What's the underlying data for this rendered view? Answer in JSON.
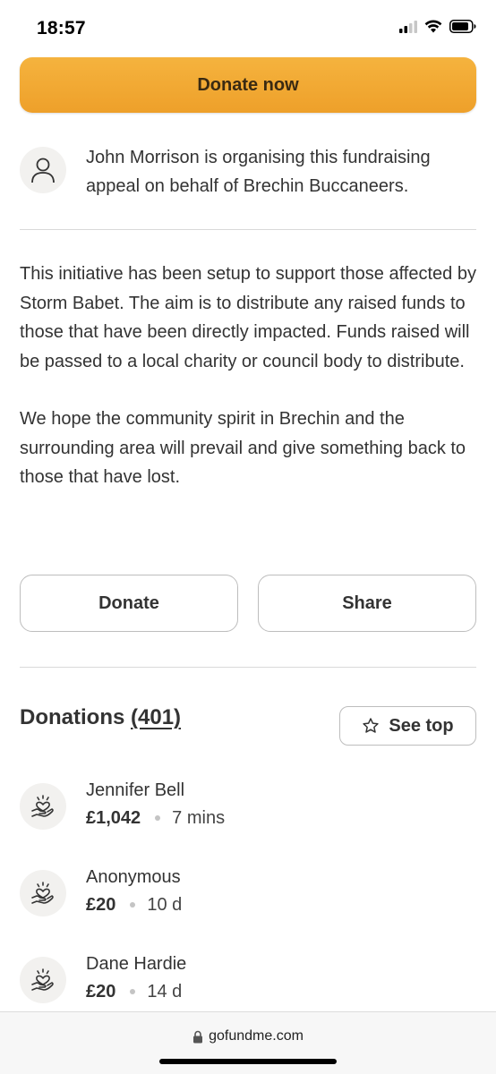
{
  "status_bar": {
    "time": "18:57"
  },
  "primary_cta": {
    "label": "Donate now"
  },
  "organiser": {
    "text": "John Morrison is organising this fundraising appeal on behalf of Brechin Buccaneers."
  },
  "story": {
    "paragraphs": [
      "This initiative has been setup to support those affected by Storm Babet. The aim is to distribute any raised funds to those that have been directly impacted. Funds raised will be passed to a local charity or council body to distribute.",
      "We hope the community spirit in Brechin and the surrounding area will prevail and give something back to those that have lost."
    ]
  },
  "actions": {
    "donate_label": "Donate",
    "share_label": "Share"
  },
  "donations": {
    "title": "Donations",
    "count": "(401)",
    "see_top_label": "See top",
    "items": [
      {
        "name": "Jennifer Bell",
        "amount": "£1,042",
        "time": "7 mins"
      },
      {
        "name": "Anonymous",
        "amount": "£20",
        "time": "10 d"
      },
      {
        "name": "Dane Hardie",
        "amount": "£20",
        "time": "14 d"
      }
    ]
  },
  "browser": {
    "url": "gofundme.com"
  },
  "colors": {
    "accent": "#f2a935",
    "text": "#333333",
    "border": "#bdbdbd",
    "icon_bg": "#f2f1ef"
  }
}
